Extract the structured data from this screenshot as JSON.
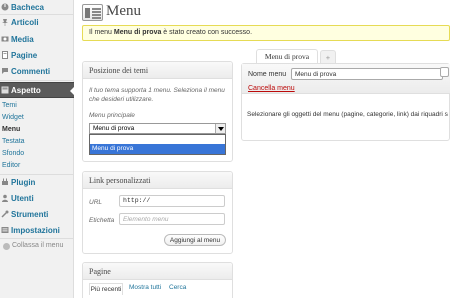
{
  "sidebar": {
    "items": [
      {
        "label": "Bacheca"
      },
      {
        "label": "Articoli"
      },
      {
        "label": "Media"
      },
      {
        "label": "Pagine"
      },
      {
        "label": "Commenti"
      },
      {
        "label": "Aspetto"
      },
      {
        "label": "Plugin"
      },
      {
        "label": "Utenti"
      },
      {
        "label": "Strumenti"
      },
      {
        "label": "Impostazioni"
      }
    ],
    "submenu": [
      "Temi",
      "Widget",
      "Menu",
      "Testata",
      "Sfondo",
      "Editor"
    ],
    "collapse_label": "Collassa il menu"
  },
  "page": {
    "title": "Menu"
  },
  "notice": {
    "prefix": "Il menu ",
    "name": "Menu di prova",
    "suffix": " è stato creato con successo."
  },
  "theme_box": {
    "title": "Posizione dei temi",
    "description": "Il tuo tema supporta 1 menu. Seleziona il menu che desideri utilizzare.",
    "label": "Menu principale",
    "selected": "Menu di prova",
    "option": "Menu di prova"
  },
  "links_box": {
    "title": "Link personalizzati",
    "url_label": "URL",
    "url_value": "http://",
    "label_label": "Etichetta",
    "label_placeholder": "Elemento menu",
    "add_button": "Aggiungi al menu"
  },
  "pages_box": {
    "title": "Pagine",
    "tabs": [
      "Più recenti",
      "Mostra tutti",
      "Cerca"
    ]
  },
  "editor": {
    "tab_label": "Menu di prova",
    "add_tab": "+",
    "name_label": "Nome menu",
    "name_value": "Menu di prova",
    "delete_link": "Cancella menu",
    "instructions": "Selezionare gli oggetti del menu (pagine, categorie, link) dai riquadri s"
  },
  "colors": {
    "link": "#21759b",
    "active_menu": "#5b5b5b",
    "notice_bg": "#ffffe0",
    "delete": "#bc0b0b",
    "selection": "#3875d7"
  }
}
